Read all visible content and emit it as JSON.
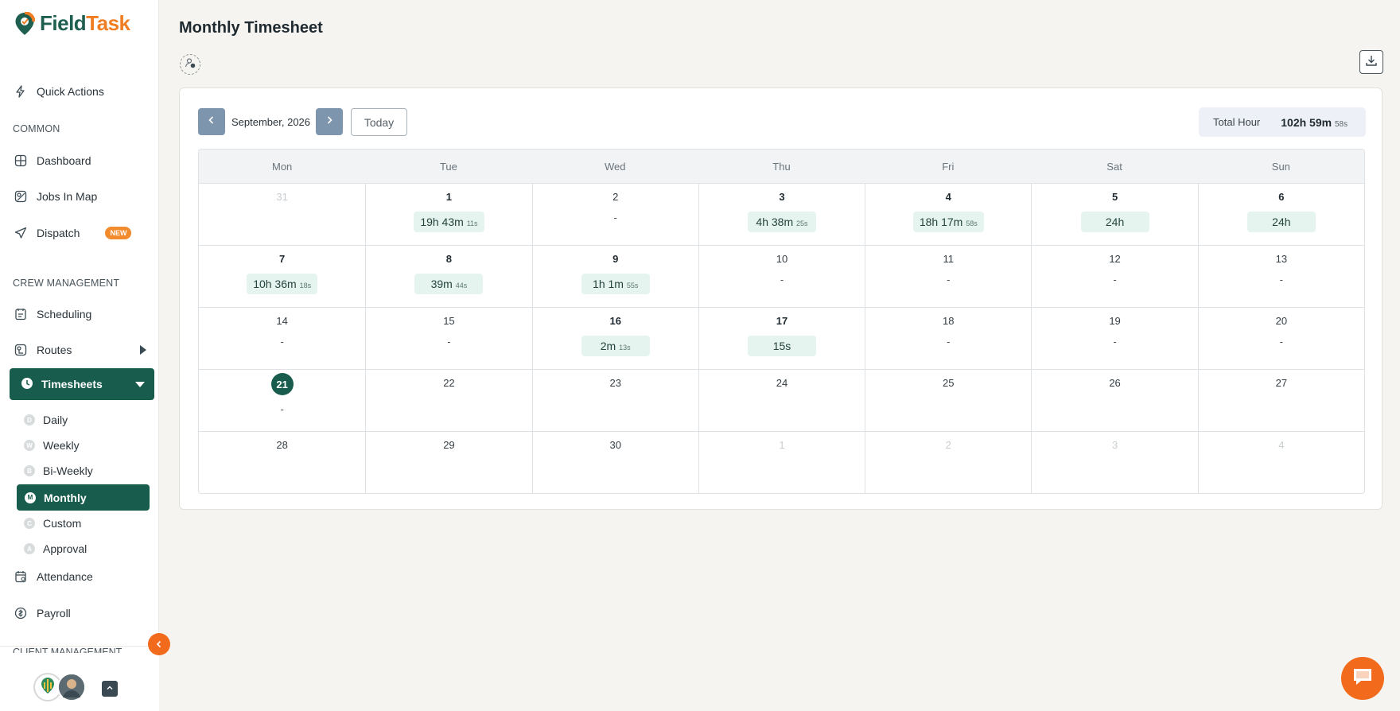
{
  "app": {
    "logo_part1": "Field",
    "logo_part2": "Task",
    "brand_colors": {
      "primary": "#175c4c",
      "accent": "#f26b1d"
    }
  },
  "sidebar": {
    "quick_actions": "Quick Actions",
    "section_common": "COMMON",
    "dashboard": "Dashboard",
    "jobs_in_map": "Jobs In Map",
    "dispatch": "Dispatch",
    "dispatch_badge": "NEW",
    "section_crew": "CREW MANAGEMENT",
    "scheduling": "Scheduling",
    "routes": "Routes",
    "timesheets": "Timesheets",
    "timesheet_subitems": [
      {
        "letter": "D",
        "label": "Daily"
      },
      {
        "letter": "W",
        "label": "Weekly"
      },
      {
        "letter": "B",
        "label": "Bi-Weekly"
      },
      {
        "letter": "M",
        "label": "Monthly"
      },
      {
        "letter": "C",
        "label": "Custom"
      },
      {
        "letter": "A",
        "label": "Approval"
      }
    ],
    "attendance": "Attendance",
    "payroll": "Payroll",
    "section_client": "CLIENT MANAGEMENT"
  },
  "page": {
    "title": "Monthly Timesheet"
  },
  "calendar": {
    "month_label": "September, 2026",
    "today_label": "Today",
    "total_label": "Total Hour",
    "total_main": "102h 59m",
    "total_sec": "58s",
    "weekdays": [
      "Mon",
      "Tue",
      "Wed",
      "Thu",
      "Fri",
      "Sat",
      "Sun"
    ],
    "weeks": [
      [
        {
          "day": "31",
          "muted": true
        },
        {
          "day": "1",
          "bold": true,
          "main": "19h 43m",
          "sec": "11s"
        },
        {
          "day": "2",
          "dash": "-"
        },
        {
          "day": "3",
          "bold": true,
          "main": "4h 38m",
          "sec": "25s"
        },
        {
          "day": "4",
          "bold": true,
          "main": "18h 17m",
          "sec": "58s"
        },
        {
          "day": "5",
          "bold": true,
          "main": "24h",
          "sec": ""
        },
        {
          "day": "6",
          "bold": true,
          "main": "24h",
          "sec": ""
        }
      ],
      [
        {
          "day": "7",
          "bold": true,
          "main": "10h 36m",
          "sec": "18s"
        },
        {
          "day": "8",
          "bold": true,
          "main": "39m",
          "sec": "44s"
        },
        {
          "day": "9",
          "bold": true,
          "main": "1h 1m",
          "sec": "55s"
        },
        {
          "day": "10",
          "dash": "-"
        },
        {
          "day": "11",
          "dash": "-"
        },
        {
          "day": "12",
          "dash": "-"
        },
        {
          "day": "13",
          "dash": "-"
        }
      ],
      [
        {
          "day": "14",
          "dash": "-"
        },
        {
          "day": "15",
          "dash": "-"
        },
        {
          "day": "16",
          "bold": true,
          "main": "2m",
          "sec": "13s"
        },
        {
          "day": "17",
          "bold": true,
          "main": "15s",
          "sec": ""
        },
        {
          "day": "18",
          "dash": "-"
        },
        {
          "day": "19",
          "dash": "-"
        },
        {
          "day": "20",
          "dash": "-"
        }
      ],
      [
        {
          "day": "21",
          "today": true,
          "dash": "-"
        },
        {
          "day": "22"
        },
        {
          "day": "23"
        },
        {
          "day": "24"
        },
        {
          "day": "25"
        },
        {
          "day": "26"
        },
        {
          "day": "27"
        }
      ],
      [
        {
          "day": "28"
        },
        {
          "day": "29"
        },
        {
          "day": "30"
        },
        {
          "day": "1",
          "muted": true
        },
        {
          "day": "2",
          "muted": true
        },
        {
          "day": "3",
          "muted": true
        },
        {
          "day": "4",
          "muted": true
        }
      ]
    ]
  }
}
